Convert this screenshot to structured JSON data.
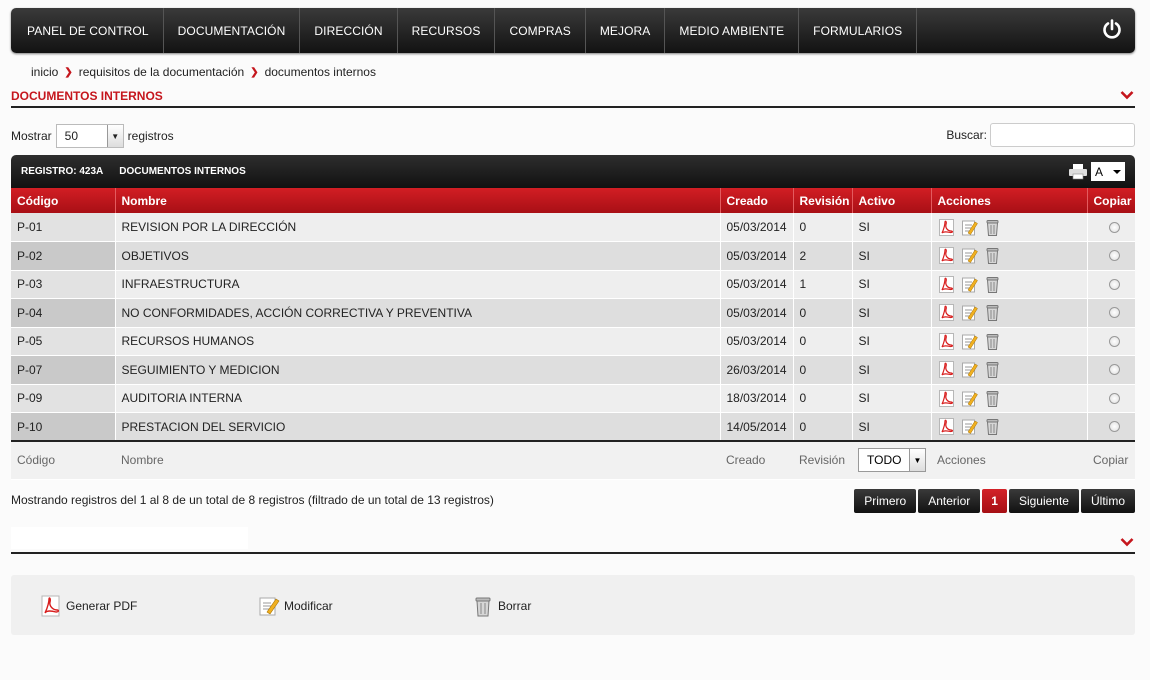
{
  "nav": {
    "items": [
      {
        "label": "PANEL DE CONTROL"
      },
      {
        "label": "DOCUMENTACIÓN"
      },
      {
        "label": "DIRECCIÓN"
      },
      {
        "label": "RECURSOS"
      },
      {
        "label": "COMPRAS"
      },
      {
        "label": "MEJORA"
      },
      {
        "label": "MEDIO AMBIENTE"
      },
      {
        "label": "FORMULARIOS"
      }
    ],
    "power_icon": "power-icon"
  },
  "breadcrumb": {
    "items": [
      "inicio",
      "requisitos de la documentación",
      "documentos internos"
    ]
  },
  "section": {
    "title": "DOCUMENTOS INTERNOS"
  },
  "controls": {
    "show_label": "Mostrar",
    "show_value": "50",
    "records_label": "registros",
    "search_label": "Buscar:",
    "search_value": ""
  },
  "table": {
    "registro_label": "REGISTRO: 423A",
    "title": "DOCUMENTOS INTERNOS",
    "font_select": "A",
    "columns": [
      "Código",
      "Nombre",
      "Creado",
      "Revisión",
      "Activo",
      "Acciones",
      "Copiar"
    ],
    "rows": [
      {
        "code": "P-01",
        "name": "REVISION POR LA DIRECCIÓN",
        "created": "05/03/2014",
        "revision": "0",
        "active": "SI"
      },
      {
        "code": "P-02",
        "name": "OBJETIVOS",
        "created": "05/03/2014",
        "revision": "2",
        "active": "SI"
      },
      {
        "code": "P-03",
        "name": "INFRAESTRUCTURA",
        "created": "05/03/2014",
        "revision": "1",
        "active": "SI"
      },
      {
        "code": "P-04",
        "name": "NO CONFORMIDADES, ACCIÓN CORRECTIVA Y PREVENTIVA",
        "created": "05/03/2014",
        "revision": "0",
        "active": "SI"
      },
      {
        "code": "P-05",
        "name": "RECURSOS HUMANOS",
        "created": "05/03/2014",
        "revision": "0",
        "active": "SI"
      },
      {
        "code": "P-07",
        "name": "SEGUIMIENTO Y MEDICION",
        "created": "26/03/2014",
        "revision": "0",
        "active": "SI"
      },
      {
        "code": "P-09",
        "name": "AUDITORIA INTERNA",
        "created": "18/03/2014",
        "revision": "0",
        "active": "SI"
      },
      {
        "code": "P-10",
        "name": "PRESTACION DEL SERVICIO",
        "created": "14/05/2014",
        "revision": "0",
        "active": "SI"
      }
    ],
    "footer": {
      "code": "Código",
      "name": "Nombre",
      "created": "Creado",
      "revision": "Revisión",
      "active_filter": "TODO",
      "actions": "Acciones",
      "copy": "Copiar"
    }
  },
  "info": "Mostrando registros del 1 al 8 de un total de 8 registros (filtrado de un total de 13 registros)",
  "pager": {
    "first": "Primero",
    "prev": "Anterior",
    "current": "1",
    "next": "Siguiente",
    "last": "Último"
  },
  "legend": {
    "pdf": "Generar PDF",
    "edit": "Modificar",
    "delete": "Borrar"
  },
  "colors": {
    "accent": "#c5161d",
    "nav_bg": "#1e1e1e"
  }
}
